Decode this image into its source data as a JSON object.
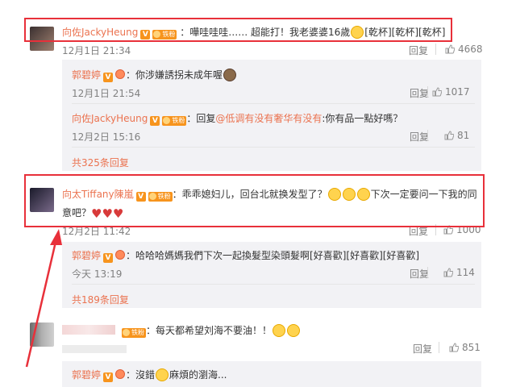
{
  "c1": {
    "name": "向佐JackyHeung",
    "text": "：嘩哇哇哇…… 超能打！我老婆婆16歲",
    "tags": "[乾杯][乾杯][乾杯]",
    "time": "12月1日 21:34",
    "reply": "回复",
    "likes": "4668",
    "fan_label": "铁粉"
  },
  "r1": {
    "name": "郭碧婷",
    "text": "：你涉嫌誘拐未成年喔",
    "time": "12月1日 21:54",
    "reply": "回复",
    "likes": "1017"
  },
  "r2": {
    "name": "向佐JackyHeung",
    "prefix": "：回复",
    "mention": "@低调有没有奢华有没有",
    "text": ":你有品一點好嗎？",
    "time": "12月2日 15:16",
    "reply": "回复",
    "likes": "81"
  },
  "more1": "共325条回复",
  "c2": {
    "name": "向太Tiffany陳嵐",
    "fan_label": "铁粉",
    "text": "：乖乖媳妇儿，回台北就换发型了？",
    "text2": "下次一定要问一下我的同",
    "text3": "意吧？",
    "time": "12月2日 11:42",
    "reply": "回复",
    "likes": "1000"
  },
  "r3": {
    "name": "郭碧婷",
    "text": "：哈哈哈媽媽我們下次一起換髮型染頭髮啊[好喜歡][好喜歡][好喜歡]",
    "time": "今天 13:19",
    "reply": "回复",
    "likes": "114"
  },
  "more2": "共189条回复",
  "c3": {
    "fan_label": "铁粉",
    "text": "：每天都希望刘海不要油！！",
    "reply": "回复",
    "likes": "851"
  },
  "r4": {
    "name": "郭碧婷",
    "text": "：沒錯",
    "text2": "麻煩的瀏海..."
  },
  "colors": {
    "accent": "#eb7350",
    "highlight_box": "#e8303a",
    "reply_bg": "#f2f2f5"
  }
}
